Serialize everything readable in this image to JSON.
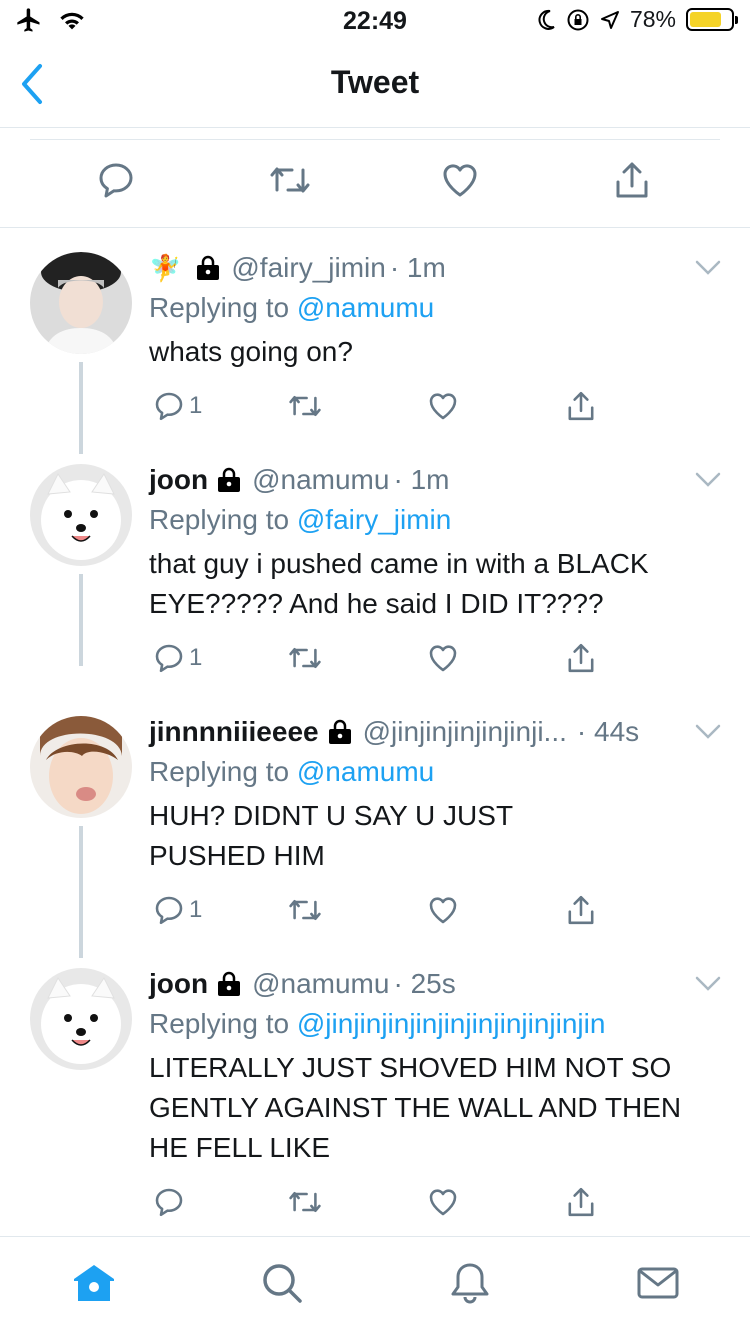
{
  "status_bar": {
    "time": "22:49",
    "battery_percent": "78%",
    "battery_level": 0.78
  },
  "nav": {
    "title": "Tweet"
  },
  "colors": {
    "accent": "#1da1f2",
    "muted": "#657786",
    "thread": "#ccd6dd"
  },
  "tweets": [
    {
      "emoji": "🧚",
      "name": "",
      "handle": "@fairy_jimin",
      "time": "· 1m",
      "replying_label": "Replying to",
      "replying_to": "@namumu",
      "text": "whats going on?",
      "reply_count": "1"
    },
    {
      "name": "joon",
      "handle": "@namumu",
      "time": "· 1m",
      "replying_label": "Replying to",
      "replying_to": "@fairy_jimin",
      "text_line1": "that guy i pushed came in with a BLACK",
      "text_line2": "EYE????? And he said I DID IT????",
      "reply_count": "1"
    },
    {
      "name": "jinnnniiieeee",
      "handle": "@jinjinjinjinjinji...",
      "time": "· 44s",
      "replying_label": "Replying to",
      "replying_to": "@namumu",
      "text_line1": "HUH? DIDNT U SAY U JUST",
      "text_line2": "PUSHED HIM",
      "reply_count": "1"
    },
    {
      "name": "joon",
      "handle": "@namumu",
      "time": "· 25s",
      "replying_label": "Replying to",
      "replying_to": "@jinjinjinjinjinjinjinjinjinjin",
      "text_line1": "LITERALLY JUST SHOVED HIM NOT SO",
      "text_line2": "GENTLY AGAINST THE WALL AND THEN",
      "text_line3": "HE FELL LIKE",
      "reply_count": ""
    }
  ]
}
